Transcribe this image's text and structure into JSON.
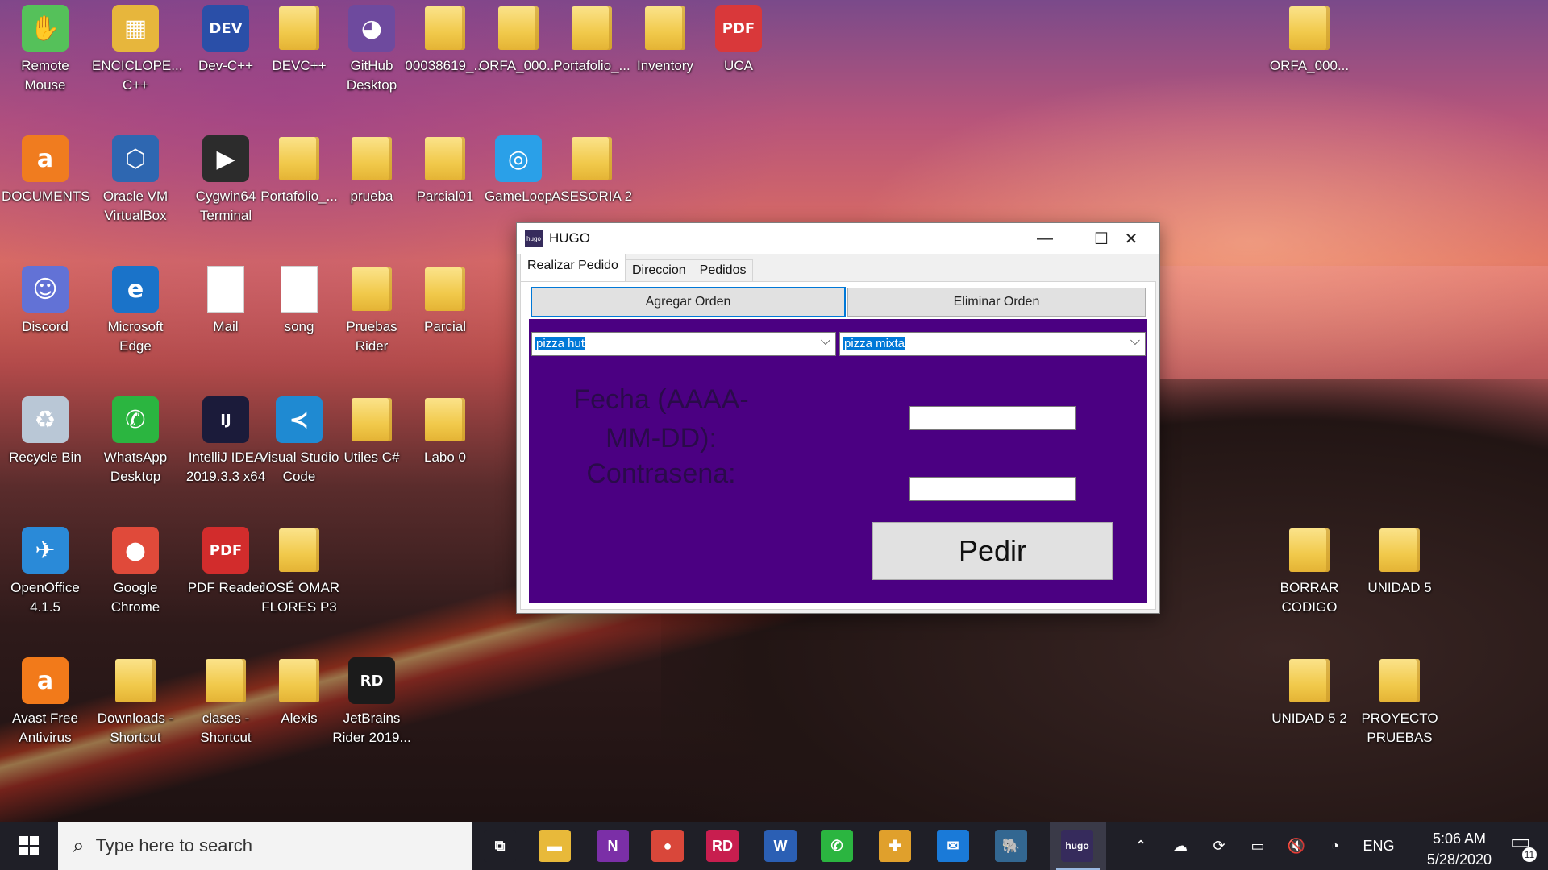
{
  "desktop": {
    "icons": [
      {
        "label": "Remote Mouse",
        "glyph": "✋",
        "color": "#55c15a"
      },
      {
        "label": "ENCICLOPE... C++",
        "glyph": "▦",
        "color": "#e7b63c"
      },
      {
        "label": "Dev-C++",
        "glyph": "DEV",
        "color": "#2a4fa8"
      },
      {
        "label": "DEVC++",
        "glyph": "",
        "color": "folder"
      },
      {
        "label": "GitHub Desktop",
        "glyph": "◕",
        "color": "#6e4a9e"
      },
      {
        "label": "00038619_...",
        "glyph": "",
        "color": "folder"
      },
      {
        "label": "ORFA_000...",
        "glyph": "",
        "color": "folder"
      },
      {
        "label": "Portafolio_...",
        "glyph": "",
        "color": "folder"
      },
      {
        "label": "Inventory",
        "glyph": "",
        "color": "folder"
      },
      {
        "label": "UCA",
        "glyph": "PDF",
        "color": "#d9383a"
      },
      {
        "label": "ORFA_000...",
        "glyph": "",
        "color": "folder"
      },
      {
        "label": "DOCUMENTS",
        "glyph": "a",
        "color": "#f07c1f"
      },
      {
        "label": "Oracle VM VirtualBox",
        "glyph": "⬡",
        "color": "#2e67b1"
      },
      {
        "label": "Cygwin64 Terminal",
        "glyph": "▶",
        "color": "#2c2c2c"
      },
      {
        "label": "Portafolio_...",
        "glyph": "",
        "color": "folder"
      },
      {
        "label": "prueba",
        "glyph": "",
        "color": "folder"
      },
      {
        "label": "Parcial01",
        "glyph": "",
        "color": "folder"
      },
      {
        "label": "GameLoop",
        "glyph": "◎",
        "color": "#2aa0e8"
      },
      {
        "label": "ASESORIA 2",
        "glyph": "",
        "color": "folder"
      },
      {
        "label": "Discord",
        "glyph": "☺",
        "color": "#6272d6"
      },
      {
        "label": "Microsoft Edge",
        "glyph": "e",
        "color": "#1a73c9"
      },
      {
        "label": "Mail",
        "glyph": "",
        "color": "doc"
      },
      {
        "label": "song",
        "glyph": "",
        "color": "doc"
      },
      {
        "label": "Pruebas Rider",
        "glyph": "",
        "color": "folder"
      },
      {
        "label": "Parcial",
        "glyph": "",
        "color": "folder"
      },
      {
        "label": "Recycle Bin",
        "glyph": "♻",
        "color": "#b9c7d6"
      },
      {
        "label": "WhatsApp Desktop",
        "glyph": "✆",
        "color": "#2bb540"
      },
      {
        "label": "IntelliJ IDEA 2019.3.3 x64",
        "glyph": "IJ",
        "color": "#1b1b3a"
      },
      {
        "label": "Visual Studio Code",
        "glyph": "≺",
        "color": "#1f8ad2"
      },
      {
        "label": "Utiles C#",
        "glyph": "",
        "color": "folder"
      },
      {
        "label": "Labo 0",
        "glyph": "",
        "color": "folder"
      },
      {
        "label": "OpenOffice 4.1.5",
        "glyph": "✈",
        "color": "#2a8ad8"
      },
      {
        "label": "Google Chrome",
        "glyph": "●",
        "color": "#e04a3a"
      },
      {
        "label": "PDF Reader",
        "glyph": "PDF",
        "color": "#d22c2c"
      },
      {
        "label": "JOSÉ OMAR FLORES P3",
        "glyph": "",
        "color": "folder"
      },
      {
        "label": "BORRAR CODIGO",
        "glyph": "",
        "color": "folder"
      },
      {
        "label": "UNIDAD 5",
        "glyph": "",
        "color": "folder"
      },
      {
        "label": "Avast Free Antivirus",
        "glyph": "a",
        "color": "#f27a1a"
      },
      {
        "label": "Downloads - Shortcut",
        "glyph": "",
        "color": "folder"
      },
      {
        "label": "clases - Shortcut",
        "glyph": "",
        "color": "folder"
      },
      {
        "label": "Alexis",
        "glyph": "",
        "color": "folder"
      },
      {
        "label": "JetBrains Rider 2019...",
        "glyph": "RD",
        "color": "#1b1b1b"
      },
      {
        "label": "UNIDAD 5 2",
        "glyph": "",
        "color": "folder"
      },
      {
        "label": "PROYECTO PRUEBAS",
        "glyph": "",
        "color": "folder"
      }
    ]
  },
  "window": {
    "title": "HUGO",
    "app_icon_text": "hugo",
    "controls": {
      "minimize": "—",
      "maximize": "☐",
      "close": "✕"
    },
    "tabs": [
      "Realizar Pedido",
      "Direccion",
      "Pedidos"
    ],
    "buttons": {
      "add_order": "Agregar Orden",
      "remove_order": "Eliminar Orden"
    },
    "form": {
      "restaurant_value": "pizza hut",
      "product_value": "pizza mixta",
      "date_label": "Fecha (AAAA-MM-DD):",
      "password_label": "Contrasena:",
      "submit": "Pedir"
    },
    "colors": {
      "panel": "#4b0082",
      "label": "#2a0b4a"
    }
  },
  "taskbar": {
    "search_placeholder": "Type here to search",
    "apps": [
      {
        "name": "task-view",
        "glyph": "⧉",
        "color": "#1f1f27"
      },
      {
        "name": "file-explorer",
        "glyph": "▬",
        "color": "#e8b93a"
      },
      {
        "name": "onenote",
        "glyph": "N",
        "color": "#7b2fa7"
      },
      {
        "name": "chrome",
        "glyph": "●",
        "color": "#d9473a"
      },
      {
        "name": "rider",
        "glyph": "RD",
        "color": "#c81e4f"
      },
      {
        "name": "word",
        "glyph": "W",
        "color": "#2b5fb4"
      },
      {
        "name": "whatsapp",
        "glyph": "✆",
        "color": "#2bb540"
      },
      {
        "name": "slack",
        "glyph": "✚",
        "color": "#e0a02c"
      },
      {
        "name": "mail",
        "glyph": "✉",
        "color": "#1a7ad8"
      },
      {
        "name": "postgres",
        "glyph": "🐘",
        "color": "#336791"
      },
      {
        "name": "hugo",
        "glyph": "hugo",
        "color": "#362b5c"
      }
    ],
    "tray": {
      "language": "ENG",
      "time": "5:06 AM",
      "date": "5/28/2020",
      "notifications": "11"
    }
  }
}
